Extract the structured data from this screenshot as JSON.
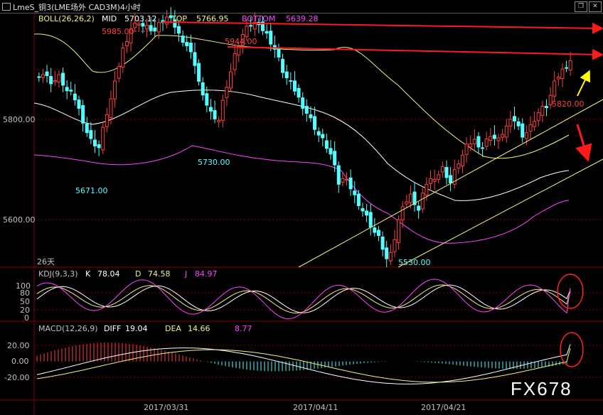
{
  "window": {
    "title": "LmeS_铜3(LME场外 CAD3M)4小时",
    "buttons": [
      "restore-icon",
      "close-icon"
    ]
  },
  "boll": {
    "header": "BOLL(26,26,2)",
    "mid_label": "MID",
    "mid_value": "5703.12",
    "top_label": "TOP",
    "top_value": "5766.95",
    "bottom_label": "BOTTOM",
    "bottom_value": "5639.28",
    "period_label": "26天"
  },
  "kdj": {
    "header": "KDJ(9,3,3)",
    "k_label": "K",
    "k_value": "78.04",
    "d_label": "D",
    "d_value": "74.58",
    "j_label": "J",
    "j_value": "84.97"
  },
  "macd": {
    "header": "MACD(12,26,9)",
    "diff_label": "DIFF",
    "diff_value": "19.04",
    "dea_label": "DEA",
    "dea_value": "14.66",
    "hist_value": "8.77"
  },
  "watermark": "FX678",
  "colors": {
    "up": "#ff4040",
    "down": "#54ffff",
    "mid": "#ffffff",
    "band": "#f4f084",
    "bottom_band": "#ff44ff",
    "arrow_red": "#ff1a1a",
    "arrow_yellow": "#ffff00",
    "circle": "#ff2020",
    "grid": "#8b0000"
  },
  "chart_data": [
    {
      "type": "candlestick",
      "title": "LmeS_铜3(LME场外 CAD3M)4小时",
      "y_ticks": [
        "5800.00",
        "5600.00"
      ],
      "ylim": [
        5520,
        5880
      ],
      "x_tick_labels": [
        "2017/03/31",
        "2017/04/11",
        "2017/04/21"
      ],
      "annotations": [
        {
          "text": "5985.00",
          "value": 5985
        },
        {
          "text": "5944.00",
          "value": 5944
        },
        {
          "text": "5730.00",
          "value": 5730
        },
        {
          "text": "5671.00",
          "value": 5671
        },
        {
          "text": "5530.00",
          "value": 5530
        },
        {
          "text": "5820.00",
          "value": 5820
        }
      ],
      "series": [
        {
          "name": "MID",
          "value": 5703.12
        },
        {
          "name": "TOP",
          "value": 5766.95
        },
        {
          "name": "BOTTOM",
          "value": 5639.28
        }
      ],
      "close_path": [
        5795,
        5785,
        5790,
        5770,
        5760,
        5730,
        5700,
        5690,
        5740,
        5780,
        5830,
        5860,
        5870,
        5860,
        5855,
        5870,
        5880,
        5850,
        5835,
        5810,
        5760,
        5740,
        5730,
        5780,
        5820,
        5850,
        5865,
        5870,
        5850,
        5830,
        5800,
        5780,
        5760,
        5740,
        5720,
        5700,
        5680,
        5640,
        5650,
        5620,
        5600,
        5580,
        5560,
        5530,
        5560,
        5610,
        5620,
        5600,
        5640,
        5650,
        5660,
        5640,
        5670,
        5690,
        5700,
        5690,
        5710,
        5700,
        5720,
        5730,
        5710,
        5720,
        5740,
        5750,
        5780,
        5800,
        5815
      ],
      "annotation_labels_shown": true
    },
    {
      "type": "line",
      "title": "KDJ(9,3,3)",
      "y_ticks": [
        "100",
        "80",
        "50",
        "20",
        "0"
      ],
      "ylim": [
        -20,
        115
      ],
      "series": [
        {
          "name": "K",
          "last": 78.04
        },
        {
          "name": "D",
          "last": 74.58
        },
        {
          "name": "J",
          "last": 84.97
        }
      ]
    },
    {
      "type": "bar",
      "title": "MACD(12,26,9)",
      "y_ticks": [
        "20.00",
        "0.00",
        "-20.00"
      ],
      "ylim": [
        -42,
        32
      ],
      "series": [
        {
          "name": "DIFF",
          "last": 19.04
        },
        {
          "name": "DEA",
          "last": 14.66
        },
        {
          "name": "MACD",
          "last": 8.77
        }
      ]
    }
  ]
}
